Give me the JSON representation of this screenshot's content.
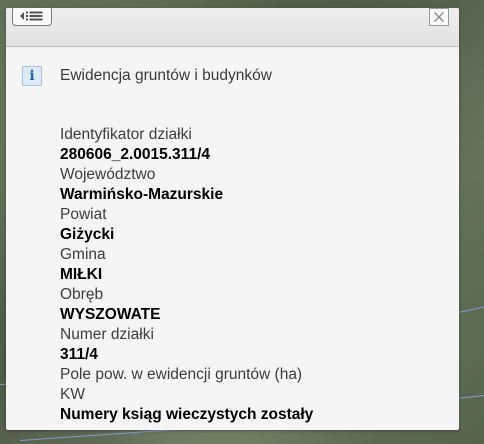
{
  "panel": {
    "menu_icon": "list-menu-icon",
    "close_icon": "close-icon",
    "section_icon": "info-icon",
    "section_icon_glyph": "i",
    "section_title": "Ewidencja gruntów i budynków"
  },
  "properties": [
    {
      "label": "Identyfikator działki",
      "value": "280606_2.0015.311/4"
    },
    {
      "label": "Województwo",
      "value": "Warmińsko-Mazurskie"
    },
    {
      "label": "Powiat",
      "value": "Giżycki"
    },
    {
      "label": "Gmina",
      "value": "MIŁKI"
    },
    {
      "label": "Obręb",
      "value": "WYSZOWATE"
    },
    {
      "label": "Numer działki",
      "value": "311/4"
    },
    {
      "label": "Pole pow. w ewidencji gruntów (ha)",
      "value": ""
    },
    {
      "label": "KW",
      "value": "Numery ksiąg wieczystych zostały"
    }
  ],
  "colors": {
    "panel_background": "#f5f5f5",
    "info_icon_blue": "#2766a6",
    "map_boundary_line": "#8cb4ff"
  }
}
